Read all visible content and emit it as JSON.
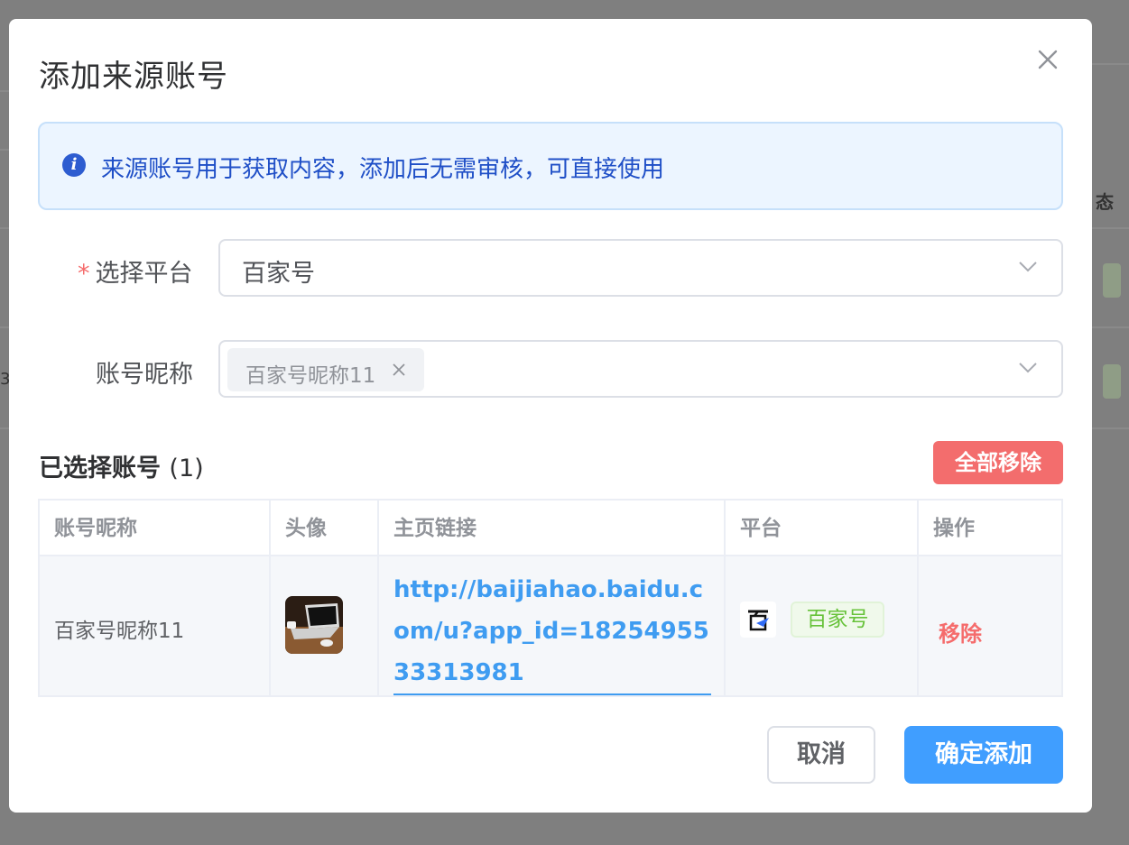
{
  "background": {
    "partial_header_text": "态",
    "partial_row_text": "3"
  },
  "dialog": {
    "title": "添加来源账号",
    "close_icon": "close-icon",
    "alert": {
      "icon": "info-icon",
      "text": "来源账号用于获取内容，添加后无需审核，可直接使用"
    },
    "platform_field": {
      "required_mark": "*",
      "label": "选择平台",
      "value": "百家号",
      "icon": "chevron-down-icon"
    },
    "nickname_field": {
      "label": "账号昵称",
      "selected_tags": [
        {
          "label": "百家号昵称11"
        }
      ],
      "icon": "chevron-down-icon"
    },
    "selected_section": {
      "title": "已选择账号",
      "count": "(1)",
      "remove_all_label": "全部移除"
    },
    "table": {
      "headers": [
        "账号昵称",
        "头像",
        "主页链接",
        "平台",
        "操作"
      ],
      "rows": [
        {
          "nickname": "百家号昵称11",
          "avatar": "laptop-avatar-image",
          "homepage_url": "http://baijiahao.baidu.com/u?app_id=1825495533313981",
          "platform_logo": "baijiahao-logo-icon",
          "platform_name": "百家号",
          "action_label": "移除"
        }
      ]
    },
    "footer": {
      "cancel_label": "取消",
      "confirm_label": "确定添加"
    },
    "colors": {
      "primary": "#409eff",
      "danger": "#f56c6c",
      "success": "#67c23a",
      "alert_bg": "#ecf5ff"
    }
  }
}
